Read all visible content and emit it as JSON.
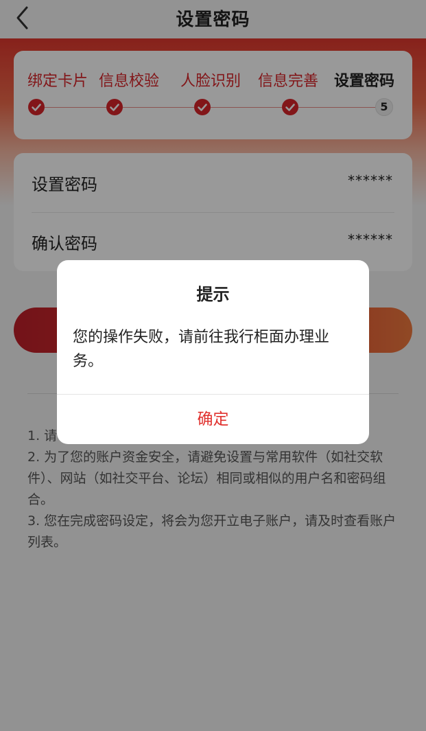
{
  "header": {
    "title": "设置密码"
  },
  "steps": [
    {
      "label": "绑定卡片",
      "status": "done"
    },
    {
      "label": "信息校验",
      "status": "done"
    },
    {
      "label": "人脸识别",
      "status": "done"
    },
    {
      "label": "信息完善",
      "status": "done"
    },
    {
      "label": "设置密码",
      "status": "current",
      "number": "5"
    }
  ],
  "form": {
    "password_label": "设置密码",
    "password_value": "******",
    "confirm_label": "确认密码",
    "confirm_value": "******"
  },
  "tips": [
    "1. 请",
    "2. 为了您的账户资金安全，请避免设置与常用软件（如社交软件）、网站（如社交平台、论坛）相同或相似的用户名和密码组合。",
    "3. 您在完成密码设定，将会为您开立电子账户，请及时查看账户列表。"
  ],
  "dialog": {
    "title": "提示",
    "message": "您的操作失败，请前往我行柜面办理业务。",
    "confirm_label": "确定"
  },
  "colors": {
    "accent": "#d9262b",
    "overlay": "rgba(0,0,0,0.4)"
  }
}
